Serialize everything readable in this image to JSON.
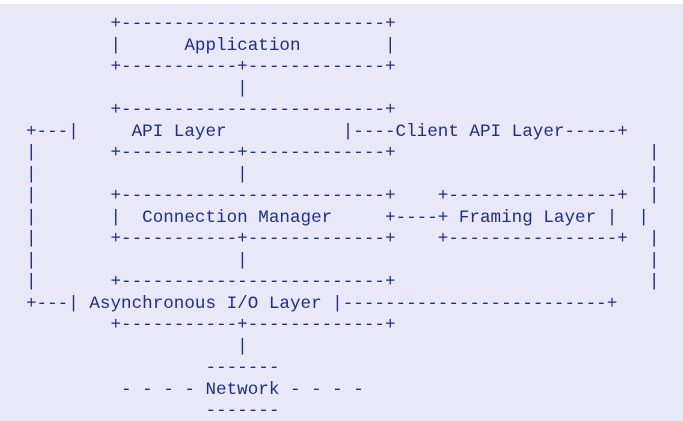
{
  "diagram": {
    "lines": [
      "        +-------------------------+",
      "        |      Application        |",
      "        +-----------+-------------+",
      "                    |",
      "        +-------------------------+",
      "+---|     API Layer           |----Client API Layer-----+",
      "|       +-----------+-------------+                        |",
      "|                   |                                      |",
      "|       +-------------------------+    +----------------+  |",
      "|       |  Connection Manager     +----+ Framing Layer |  |",
      "|       +-----------+-------------+    +----------------+  |",
      "|                   |                                      |",
      "|       +-------------------------+                        |",
      "+---| Asynchronous I/O Layer |-------------------------+",
      "        +-----------+-------------+",
      "                    |",
      "                 -------",
      "         - - - - Network - - - -",
      "                 -------"
    ]
  }
}
